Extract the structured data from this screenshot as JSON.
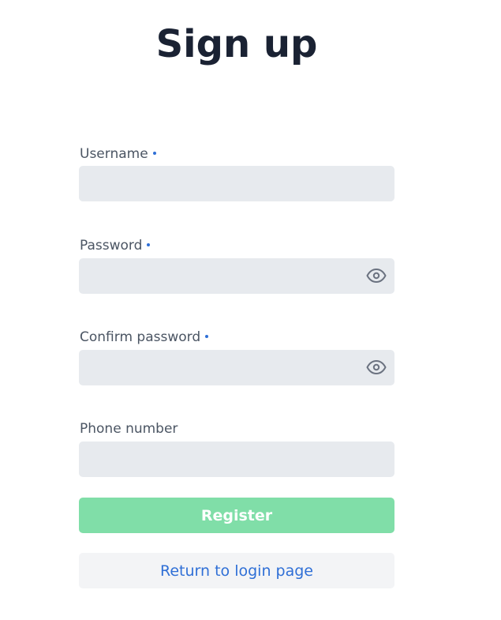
{
  "page": {
    "title": "Sign up"
  },
  "form": {
    "fields": [
      {
        "label": "Username",
        "required": true,
        "value": "",
        "type": "text"
      },
      {
        "label": "Password",
        "required": true,
        "value": "",
        "type": "password",
        "icon": "eye-icon"
      },
      {
        "label": "Confirm password",
        "required": true,
        "value": "",
        "type": "password",
        "icon": "eye-icon"
      },
      {
        "label": "Phone number",
        "required": false,
        "value": "",
        "type": "text"
      }
    ],
    "register_label": "Register",
    "return_label": "Return to login page"
  },
  "colors": {
    "title": "#1a2233",
    "label": "#4b5563",
    "required_dot": "#2f6fd6",
    "input_bg": "#e7eaee",
    "register_bg": "#80dea8",
    "register_text": "#ffffff",
    "return_bg": "#f3f4f6",
    "link": "#2f6fd6",
    "icon": "#6b7280"
  }
}
